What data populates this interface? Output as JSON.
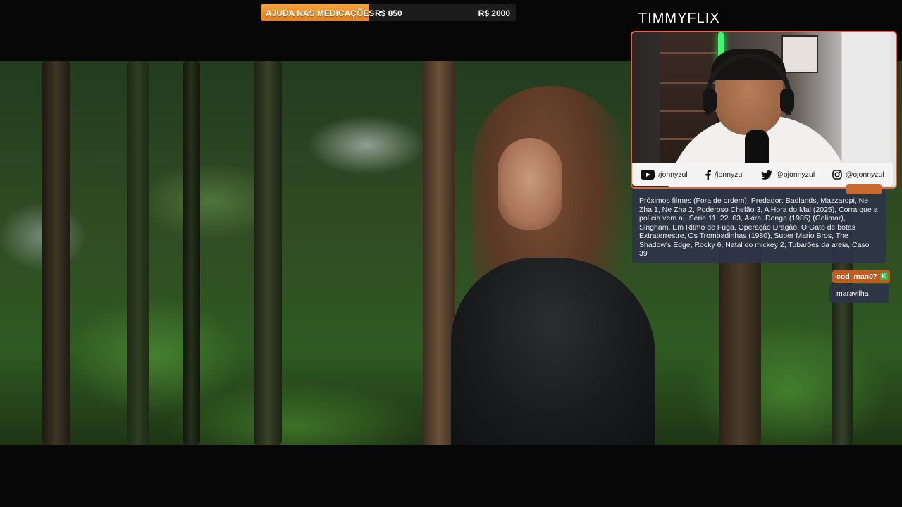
{
  "goal": {
    "title": "AJUDA NAS MEDICAÇÕES",
    "current": "R$ 850",
    "target": "R$ 2000",
    "progress_fraction": 0.425,
    "fill_color": "#f39a2e"
  },
  "channel": {
    "name": "TIMMYFLIX"
  },
  "social": {
    "youtube": "/jonnyzul",
    "facebook": "/jonnyzul",
    "twitter": "@ojonnyzul",
    "instagram": "@ojonnyzul"
  },
  "chat": {
    "announcement": "Próximos filmes (Fora de ordem): Predador: Badlands, Mazzaropi, Ne Zha 1, Ne Zha 2, Poderoso Chefão 3, A Hora do Mal (2025), Corra que a polícia vem aí, Série 11. 22. 63, Akira, Donga (1985) (Golimar), Singham, Em Ritmo de Fuga, Operação Dragão, O Gato de botas Extraterrestre, Os Trombadinhas (1980), Super Mario Bros, The Shadow's Edge, Rocky 6, Natal do mickey 2, Tubarões da areia, Caso 39",
    "message": {
      "user": "cod_man07",
      "text": "maravilha"
    }
  },
  "colors": {
    "accent": "#e8613a",
    "chat_bg": "#2d3448",
    "username_bg": "#c35b1f"
  }
}
